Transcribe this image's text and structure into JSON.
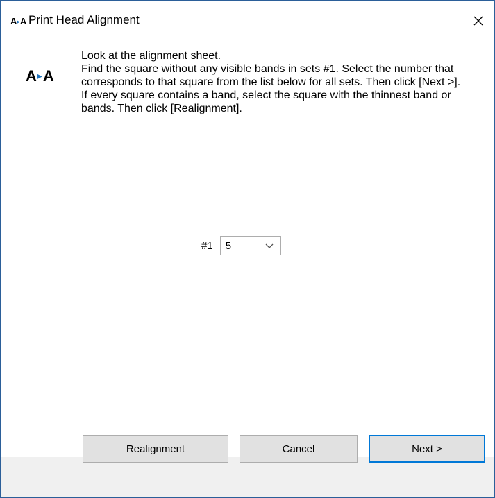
{
  "window": {
    "icon_glyph": "A▸A",
    "title": "Print Head Alignment",
    "close_glyph": "×"
  },
  "instructions": {
    "line1": "Look at the alignment sheet.",
    "line2": "Find the square without any visible bands in sets #1. Select the number that corresponds to that square from the list below for all sets. Then click [Next >].",
    "line3": "If every square contains a band, select the square with the thinnest band or bands. Then click [Realignment]."
  },
  "set_selector": {
    "label": "#1",
    "selected_value": "5"
  },
  "buttons": {
    "realignment": "Realignment",
    "cancel": "Cancel",
    "next": "Next >"
  },
  "icons": {
    "app": "alignment-icon",
    "close": "close-icon",
    "dropdown": "chevron-down-icon"
  },
  "colors": {
    "accent_blue": "#0078d7",
    "icon_arrow": "#1e73be",
    "button_face": "#e1e1e1"
  }
}
